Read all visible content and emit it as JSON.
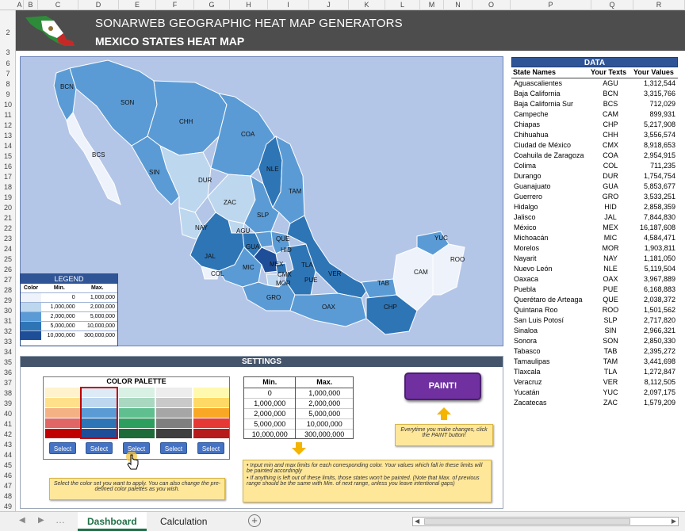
{
  "banner": {
    "title": "SONARWEB GEOGRAPHIC HEAT MAP GENERATORS",
    "subtitle": "MEXICO STATES HEAT MAP"
  },
  "columns": [
    "A",
    "B",
    "C",
    "D",
    "E",
    "F",
    "G",
    "H",
    "I",
    "J",
    "K",
    "L",
    "M",
    "N",
    "O",
    "P",
    "Q",
    "R"
  ],
  "rows": [
    "2",
    "3",
    "6",
    "7",
    "8",
    "9",
    "10",
    "11",
    "12",
    "13",
    "14",
    "15",
    "16",
    "17",
    "18",
    "19",
    "20",
    "21",
    "22",
    "23",
    "24",
    "25",
    "26",
    "27",
    "28",
    "29",
    "30",
    "31",
    "32",
    "33",
    "34",
    "35",
    "36",
    "37",
    "38",
    "39",
    "40",
    "41",
    "42",
    "43",
    "44",
    "45",
    "46",
    "47",
    "48",
    "49"
  ],
  "map_labels": [
    "BCN",
    "SON",
    "CHH",
    "COA",
    "BCS",
    "SIN",
    "DUR",
    "NLE",
    "TAM",
    "ZAC",
    "SLP",
    "NAY",
    "AGU",
    "GUA",
    "QUE",
    "HID",
    "JAL",
    "MIC",
    "MEX",
    "CMX",
    "MOR",
    "TLA",
    "PUE",
    "VER",
    "COL",
    "GRO",
    "OAX",
    "CHP",
    "TAB",
    "CAM",
    "YUC",
    "ROO"
  ],
  "legend": {
    "title": "LEGEND",
    "headers": [
      "Color",
      "Min.",
      "Max."
    ],
    "rows": [
      [
        "0",
        "1,000,000"
      ],
      [
        "1,000,000",
        "2,000,000"
      ],
      [
        "2,000,000",
        "5,000,000"
      ],
      [
        "5,000,000",
        "10,000,000"
      ],
      [
        "10,000,000",
        "300,000,000"
      ]
    ],
    "colors": [
      "#eef3fb",
      "#bdd7ee",
      "#5b9bd5",
      "#2e75b6",
      "#1f4e99"
    ]
  },
  "data_table": {
    "title": "DATA",
    "headers": [
      "State Names",
      "Your Texts",
      "Your Values"
    ],
    "rows": [
      [
        "Aguascalientes",
        "AGU",
        "1,312,544"
      ],
      [
        "Baja California",
        "BCN",
        "3,315,766"
      ],
      [
        "Baja California Sur",
        "BCS",
        "712,029"
      ],
      [
        "Campeche",
        "CAM",
        "899,931"
      ],
      [
        "Chiapas",
        "CHP",
        "5,217,908"
      ],
      [
        "Chihuahua",
        "CHH",
        "3,556,574"
      ],
      [
        "Ciudad de México",
        "CMX",
        "8,918,653"
      ],
      [
        "Coahuila de Zaragoza",
        "COA",
        "2,954,915"
      ],
      [
        "Colima",
        "COL",
        "711,235"
      ],
      [
        "Durango",
        "DUR",
        "1,754,754"
      ],
      [
        "Guanajuato",
        "GUA",
        "5,853,677"
      ],
      [
        "Guerrero",
        "GRO",
        "3,533,251"
      ],
      [
        "Hidalgo",
        "HID",
        "2,858,359"
      ],
      [
        "Jalisco",
        "JAL",
        "7,844,830"
      ],
      [
        "México",
        "MEX",
        "16,187,608"
      ],
      [
        "Michoacán",
        "MIC",
        "4,584,471"
      ],
      [
        "Morelos",
        "MOR",
        "1,903,811"
      ],
      [
        "Nayarit",
        "NAY",
        "1,181,050"
      ],
      [
        "Nuevo León",
        "NLE",
        "5,119,504"
      ],
      [
        "Oaxaca",
        "OAX",
        "3,967,889"
      ],
      [
        "Puebla",
        "PUE",
        "6,168,883"
      ],
      [
        "Querétaro de Arteaga",
        "QUE",
        "2,038,372"
      ],
      [
        "Quintana Roo",
        "ROO",
        "1,501,562"
      ],
      [
        "San Luis Potosí",
        "SLP",
        "2,717,820"
      ],
      [
        "Sinaloa",
        "SIN",
        "2,966,321"
      ],
      [
        "Sonora",
        "SON",
        "2,850,330"
      ],
      [
        "Tabasco",
        "TAB",
        "2,395,272"
      ],
      [
        "Tamaulipas",
        "TAM",
        "3,441,698"
      ],
      [
        "Tlaxcala",
        "TLA",
        "1,272,847"
      ],
      [
        "Veracruz",
        "VER",
        "8,112,505"
      ],
      [
        "Yucatán",
        "YUC",
        "2,097,175"
      ],
      [
        "Zacatecas",
        "ZAC",
        "1,579,209"
      ]
    ]
  },
  "settings": {
    "title": "SETTINGS",
    "palette_title": "COLOR PALETTE",
    "select_label": "Select",
    "palettes": [
      [
        "#fff2cc",
        "#ffe08a",
        "#f4b183",
        "#e06666",
        "#c00000"
      ],
      [
        "#ddebf7",
        "#bdd7ee",
        "#5b9bd5",
        "#2e75b6",
        "#1f4e99"
      ],
      [
        "#d9f0e4",
        "#a9d8c0",
        "#5fbf8f",
        "#2e9e5e",
        "#1e6b3a"
      ],
      [
        "#ededed",
        "#c9c9c9",
        "#a6a6a6",
        "#7f7f7f",
        "#3f3f3f"
      ],
      [
        "#fff9b0",
        "#ffd966",
        "#f9a825",
        "#e53935",
        "#b71c1c"
      ]
    ],
    "minmax_headers": [
      "Min.",
      "Max."
    ],
    "minmax_rows": [
      [
        "0",
        "1,000,000"
      ],
      [
        "1,000,000",
        "2,000,000"
      ],
      [
        "2,000,000",
        "5,000,000"
      ],
      [
        "5,000,000",
        "10,000,000"
      ],
      [
        "10,000,000",
        "300,000,000"
      ]
    ],
    "paint_label": "PAINT!",
    "note_paint": "Everytime you make changes, click the PAINT button!",
    "note_palette": "Select the color set you want to apply. You can also change the pre-defined color palettes as you wish.",
    "note_limits_1": "Input min and max limits for each corresponding color. Your values which fall in these limits will be painted accordingly",
    "note_limits_2": "If anything is left out of these limits, those states won't be painted. (Note that Max. of previous range should be the same with Min. of next range, unless you leave intentional gaps)"
  },
  "tabs": [
    "Dashboard",
    "Calculation"
  ]
}
